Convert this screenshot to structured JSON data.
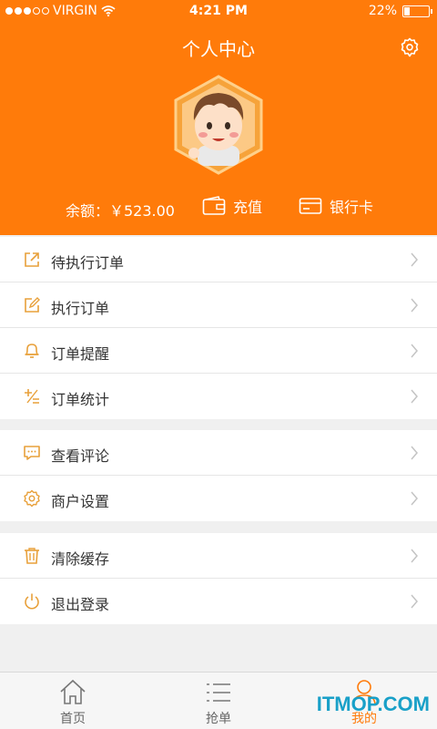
{
  "status_bar": {
    "carrier": "VIRGIN",
    "time": "4:21 PM",
    "battery_text": "22%",
    "battery_level": 0.22
  },
  "header": {
    "title": "个人中心",
    "balance": "余额：￥523.00",
    "recharge_label": "充值",
    "bank_card_label": "银行卡"
  },
  "menu_groups": [
    {
      "items": [
        {
          "label": "待执行订单",
          "icon": "external-link-icon"
        },
        {
          "label": "执行订单",
          "icon": "edit-icon"
        },
        {
          "label": "订单提醒",
          "icon": "bell-icon"
        },
        {
          "label": "订单统计",
          "icon": "plus-minus-icon"
        }
      ]
    },
    {
      "items": [
        {
          "label": "查看评论",
          "icon": "comment-icon"
        },
        {
          "label": "商户设置",
          "icon": "gear-icon"
        }
      ]
    },
    {
      "items": [
        {
          "label": "清除缓存",
          "icon": "trash-icon"
        },
        {
          "label": "退出登录",
          "icon": "power-icon"
        }
      ]
    }
  ],
  "tabbar": {
    "tabs": [
      {
        "label": "首页",
        "icon": "home-icon",
        "active": false
      },
      {
        "label": "抢单",
        "icon": "list-icon",
        "active": false
      },
      {
        "label": "我的",
        "icon": "user-icon",
        "active": true
      }
    ]
  },
  "watermark": "ITMOP.COM",
  "colors": {
    "accent": "#ff7b0a",
    "icon": "#e8a03a"
  }
}
